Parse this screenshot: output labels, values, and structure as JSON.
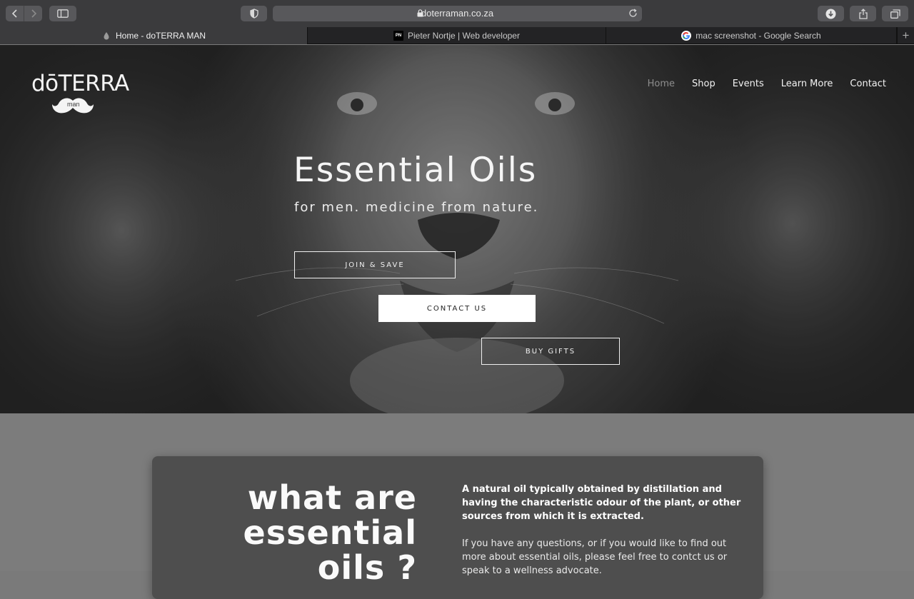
{
  "browser": {
    "url": "doterraman.co.za",
    "tabs": [
      {
        "title": "Home - doTERRA MAN",
        "favicon": "doterra-drop-icon"
      },
      {
        "title": "Pieter Nortje | Web developer",
        "favicon": "pn-logo-icon"
      },
      {
        "title": "mac screenshot - Google Search",
        "favicon": "google-g-icon"
      }
    ],
    "new_tab_label": "+"
  },
  "site": {
    "logo_word": "dōTERRA",
    "logo_sub": "man",
    "nav": [
      "Home",
      "Shop",
      "Events",
      "Learn More",
      "Contact"
    ],
    "hero": {
      "title": "Essential Oils",
      "subtitle": "for men. medicine from nature.",
      "buttons": {
        "join": "JOIN & SAVE",
        "contact": "CONTACT US",
        "gifts": "BUY GIFTS"
      }
    },
    "section": {
      "heading_lines": [
        "what are",
        "essential",
        "oils ?"
      ],
      "definition": "A natural oil typically obtained by distillation and having the characteristic odour of the plant, or other sources from which it is extracted.",
      "body": "If you have any questions, or if you would like to find out more about essential oils, please feel free to contct us or speak to a wellness advocate."
    }
  },
  "colors": {
    "chrome": "#3b3b3d",
    "tabbar": "#232325",
    "section_bg": "#7c7c7c",
    "card_bg": "#4e4e4e",
    "nav_current": "#8e8e8e"
  }
}
